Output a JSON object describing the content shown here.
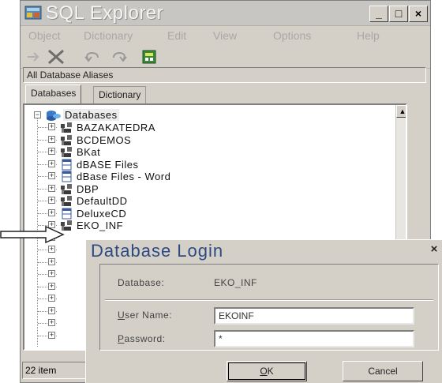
{
  "window": {
    "title": "SQL Explorer",
    "controls": {
      "minimize": "_",
      "maximize": "□",
      "close": "×"
    }
  },
  "menu": [
    "Object",
    "Dictionary",
    "Edit",
    "View",
    "Options",
    "Help"
  ],
  "toolbar": {
    "icons": [
      "apply-icon",
      "cancel-x-icon",
      "undo-icon",
      "redo-icon",
      "database-wizard-icon"
    ]
  },
  "alias_field": {
    "value": "All Database Aliases"
  },
  "tabs": [
    {
      "label": "Databases",
      "active": true
    },
    {
      "label": "Dictionary",
      "active": false
    }
  ],
  "tree": {
    "root": "Databases",
    "items": [
      {
        "label": "BAZAKATEDRA",
        "icon": "database-icon"
      },
      {
        "label": "BCDEMOS",
        "icon": "database-icon"
      },
      {
        "label": "BKat",
        "icon": "database-icon"
      },
      {
        "label": "dBASE Files",
        "icon": "table-icon"
      },
      {
        "label": "dBase Files - Word",
        "icon": "table-icon"
      },
      {
        "label": "DBP",
        "icon": "database-icon"
      },
      {
        "label": "DefaultDD",
        "icon": "database-icon"
      },
      {
        "label": "DeluxeCD",
        "icon": "table-icon"
      },
      {
        "label": "EKO_INF",
        "icon": "database-icon"
      }
    ],
    "more_expanders": 9
  },
  "status": {
    "text": "22 item"
  },
  "dialog": {
    "title": "Database Login",
    "close": "×",
    "database_label": "Database:",
    "database_value": "EKO_INF",
    "username_label_u": "U",
    "username_label_rest": "ser Name:",
    "username_value": "EKOINF",
    "password_label_u": "P",
    "password_label_rest": "assword:",
    "password_value": "*",
    "ok_label_u": "O",
    "ok_label_rest": "K",
    "cancel_label": "Cancel"
  },
  "colors": {
    "window_bg": "#d4d0c8",
    "dialog_title": "#2c4a84",
    "title_text": "#f4f4f4"
  }
}
